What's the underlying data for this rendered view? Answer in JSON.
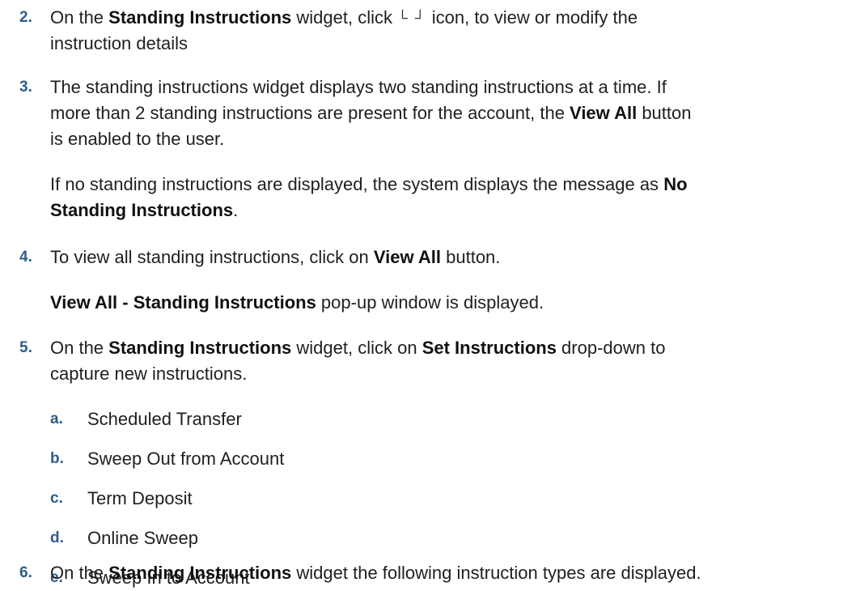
{
  "steps": [
    {
      "number": "2.",
      "pre": "On the ",
      "bold1": "Standing Instructions",
      "mid1": " widget, click ",
      "icon": "expand-icon",
      "icon_glyph": "└ ┘",
      "post": " icon, to view or modify the",
      "line2": "instruction details"
    },
    {
      "number": "3.",
      "line1": "The standing instructions widget displays two standing instructions at a time. If",
      "line2_pre": "more than 2 standing instructions are present for the account, the ",
      "line2_bold": "View All",
      "line2_post": " button",
      "line3": "is enabled to the user.",
      "para2_pre": "If no standing instructions are displayed, the system displays the message as ",
      "para2_bold_a": "No",
      "para2_bold_b": "Standing Instructions",
      "para2_post": "."
    },
    {
      "number": "4.",
      "pre": "To view all standing instructions, click on ",
      "bold": "View All",
      "post": " button.",
      "para2_bold": "View All - Standing Instructions",
      "para2_post": " pop-up window is displayed."
    },
    {
      "number": "5.",
      "pre": "On the ",
      "bold1": "Standing Instructions",
      "mid": " widget, click on ",
      "bold2": "Set Instructions",
      "post": " drop-down to",
      "line2": "capture new instructions.",
      "sub_items": [
        {
          "letter": "a.",
          "text": "Scheduled Transfer"
        },
        {
          "letter": "b.",
          "text": "Sweep Out from Account"
        },
        {
          "letter": "c.",
          "text": "Term Deposit"
        },
        {
          "letter": "d.",
          "text": "Online Sweep"
        },
        {
          "letter": "e.",
          "text": "Sweep In to Account"
        }
      ]
    },
    {
      "number": "6.",
      "pre": "On the ",
      "bold": "Standing Instructions",
      "post": " widget the following instruction types are displayed."
    }
  ],
  "colors": {
    "accent": "#2f5d8a",
    "text": "#1f1f1f"
  }
}
